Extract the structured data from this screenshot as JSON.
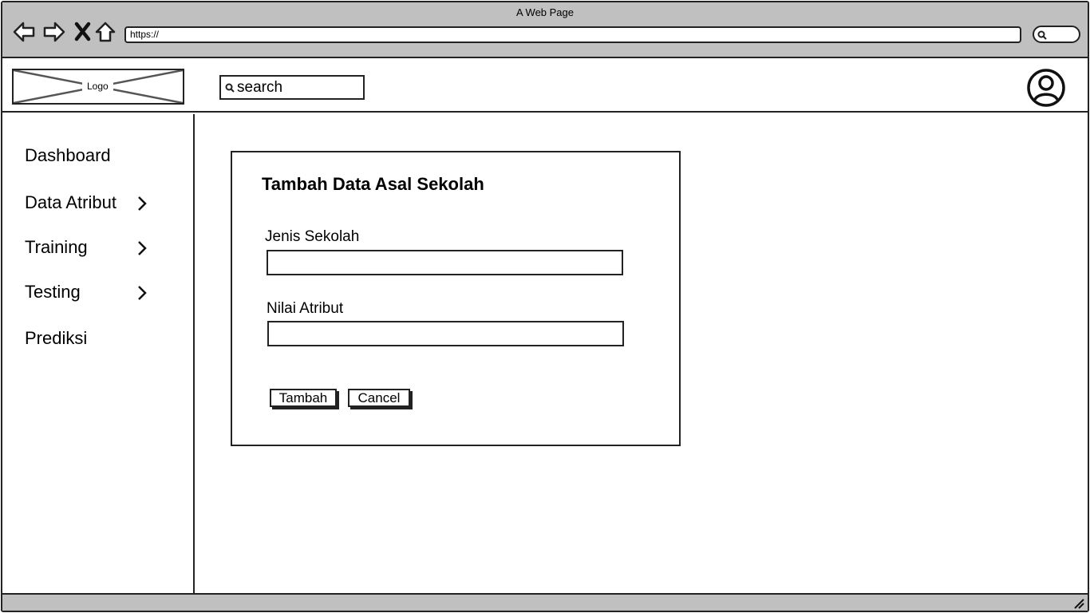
{
  "browser": {
    "window_title": "A Web Page",
    "url": "https://"
  },
  "header": {
    "logo_label": "Logo",
    "search_placeholder": "search"
  },
  "sidebar": {
    "items": [
      {
        "label": "Dashboard",
        "has_submenu": false
      },
      {
        "label": "Data Atribut",
        "has_submenu": true
      },
      {
        "label": "Training",
        "has_submenu": true
      },
      {
        "label": "Testing",
        "has_submenu": true
      },
      {
        "label": "Prediksi",
        "has_submenu": false
      }
    ]
  },
  "form": {
    "title": "Tambah Data Asal Sekolah",
    "fields": [
      {
        "label": "Jenis Sekolah",
        "value": ""
      },
      {
        "label": "Nilai Atribut",
        "value": ""
      }
    ],
    "submit_label": "Tambah",
    "cancel_label": "Cancel"
  },
  "icons": {
    "back": "back-arrow-icon",
    "forward": "forward-arrow-icon",
    "stop": "close-icon",
    "home": "home-icon",
    "search": "search-icon",
    "user": "user-circle-icon",
    "chevron": "chevron-right-icon",
    "resize": "resize-grip-icon"
  }
}
